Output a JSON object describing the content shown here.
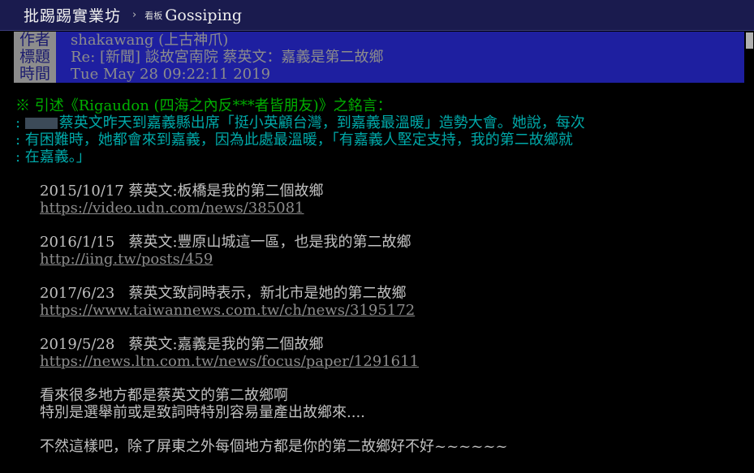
{
  "topbar": {
    "site_name": "批踢踢實業坊",
    "separator": "›",
    "board_label": "看板",
    "board_name": "Gossiping"
  },
  "header": {
    "author_tag": "作者",
    "author": "shakawang (上古神爪)",
    "title_tag": "標題",
    "title": "Re: [新聞] 談故宮南院 蔡英文：嘉義是第二故鄉",
    "time_tag": "時間",
    "time": "Tue May 28 09:22:11 2019"
  },
  "quote": {
    "header": "※ 引述《Rigaudon (四海之內反***者皆朋友)》之銘言：",
    "line1_prefix": ": ",
    "line1": "蔡英文昨天到嘉義縣出席「挺小英顧台灣，到嘉義最溫暖」造勢大會。她說，每次",
    "line2": ": 有困難時，她都會來到嘉義，因為此處最溫暖，「有嘉義人堅定支持，我的第二故鄉就",
    "line3": ": 在嘉義。」"
  },
  "entries": [
    {
      "text": "2015/10/17 蔡英文:板橋是我的第二個故鄉",
      "url": "https://video.udn.com/news/385081"
    },
    {
      "text": "2016/1/15   蔡英文:豐原山城這一區，也是我的第二故鄉",
      "url": "http://iing.tw/posts/459"
    },
    {
      "text": "2017/6/23   蔡英文致詞時表示，新北市是她的第二故鄉",
      "url": "https://www.taiwannews.com.tw/ch/news/3195172"
    },
    {
      "text": "2019/5/28   蔡英文:嘉義是我的第二個故鄉",
      "url": "https://news.ltn.com.tw/news/focus/paper/1291611"
    }
  ],
  "closing": {
    "line1": "看來很多地方都是蔡英文的第二故鄉啊",
    "line2": "特別是選舉前或是致詞時特別容易量產出故鄉來....",
    "line3": "不然這樣吧，除了屏東之外每個地方都是你的第二故鄉好不好~~~~~~"
  }
}
